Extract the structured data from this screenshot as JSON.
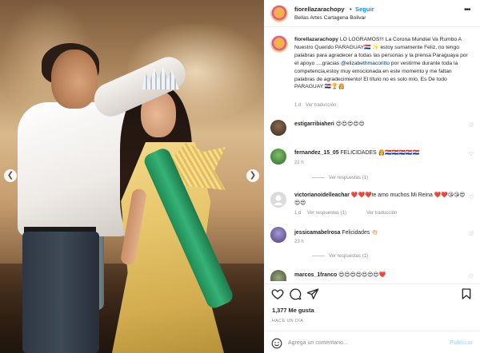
{
  "header": {
    "username": "fiorellazarachopy",
    "separator": "•",
    "follow_label": "Seguir",
    "location": "Bellas Artes Cartagena Bolivar",
    "more_icon": "more-horizontal-icon"
  },
  "caption": {
    "username": "fiorellazarachopy",
    "text_part1": " LO LOGRAMOS!!! La Corona Mundial Va Rumbo A Nuestro Querido PARAGUAY🇵🇾 ✨ estoy sumamente Feliz, no tengo palabras para agradecer a todas las personas y la prensa Paraguaya por el apoyo ....gracias ",
    "mention": "@elizabethmacoritto",
    "text_part2": " por vestirme durante toda la competencia,estoy muy emocionada en este momento y me faltan palabras de agradecimiento! El título no es solo mío, Es De todo PARAGUAY 🇵🇾🏆👸",
    "time": "1 d",
    "translate": "Ver traducción"
  },
  "comments": [
    {
      "username": "estigarribiaheri",
      "text": "😍😍😍😍😍",
      "avatar_color": "#5a4636"
    },
    {
      "username": "fernandez_15_05",
      "text": "FELICIDADES 👸🇵🇾🇵🇾🇵🇾🇵🇾🇵🇾",
      "time": "22 h",
      "replies": "Ver respuestas (1)",
      "avatar_color": "#3f7a3a"
    },
    {
      "username": "victorianoidelleachar",
      "text": "❤️❤️❤️te amo muchos Mi Reina ❤️❤️😘😘😍😍😍",
      "time": "1 d",
      "replies": "Ver respuestas (1)",
      "translate": "Ver traducción",
      "avatar_color": "#d8d8d8"
    },
    {
      "username": "jessicamabelrosa",
      "text": "Felicidades 👏🏻",
      "time": "23 h",
      "replies": "Ver respuestas (1)",
      "avatar_color": "#7a6aa8"
    },
    {
      "username": "marcos_1franco",
      "text": "😍😍😍😍😍😍😍❤️",
      "avatar_color": "#6d7a5a"
    }
  ],
  "actions": {
    "like_icon": "heart-icon",
    "comment_icon": "comment-icon",
    "share_icon": "send-icon",
    "save_icon": "bookmark-icon"
  },
  "likes": "1,377 Me gusta",
  "posted_ago": "HACE UN DÍA",
  "add_comment": {
    "placeholder": "Agrega un comentario...",
    "post_label": "Publicar",
    "emoji_icon": "smiley-icon"
  },
  "carousel": {
    "prev_icon": "chevron-left-icon",
    "next_icon": "chevron-right-icon"
  },
  "colors": {
    "link_blue": "#0095f6",
    "muted": "#8e8e8e",
    "text": "#262626",
    "mention": "#00376b"
  }
}
